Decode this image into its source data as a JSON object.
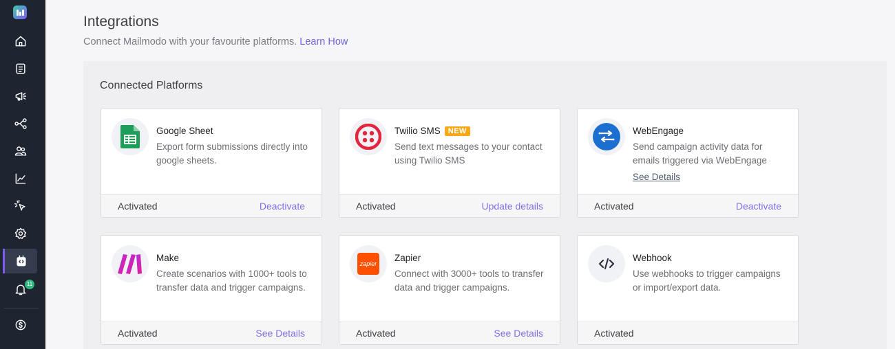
{
  "header": {
    "title": "Integrations",
    "subtitle": "Connect Mailmodo with your favourite platforms.",
    "learn_link": "Learn How"
  },
  "sidebar": {
    "notification_count": "11",
    "items": [
      {
        "icon": "home-icon"
      },
      {
        "icon": "templates-icon"
      },
      {
        "icon": "campaigns-icon"
      },
      {
        "icon": "journeys-icon"
      },
      {
        "icon": "contacts-icon"
      },
      {
        "icon": "analytics-icon"
      },
      {
        "icon": "click-icon"
      },
      {
        "icon": "settings-icon"
      },
      {
        "icon": "integrations-icon",
        "active": true
      },
      {
        "icon": "notifications-icon"
      },
      {
        "icon": "billing-icon"
      }
    ]
  },
  "section": {
    "title": "Connected Platforms"
  },
  "cards": [
    {
      "name": "Google Sheet",
      "desc": "Export form submissions directly into google sheets.",
      "status": "Activated",
      "action": "Deactivate",
      "icon": "google-sheets-icon"
    },
    {
      "name": "Twilio SMS",
      "tag": "NEW",
      "desc": "Send text messages to your contact using Twilio SMS",
      "status": "Activated",
      "action": "Update details",
      "icon": "twilio-icon"
    },
    {
      "name": "WebEngage",
      "desc": "Send campaign activity data for emails triggered via WebEngage",
      "link": "See Details",
      "status": "Activated",
      "action": "Deactivate",
      "icon": "webengage-icon"
    },
    {
      "name": "Make",
      "desc": "Create scenarios with 1000+ tools to transfer data and trigger campaigns.",
      "status": "Activated",
      "action": "See Details",
      "icon": "make-icon"
    },
    {
      "name": "Zapier",
      "icon_text": "zapier",
      "desc": "Connect with 3000+ tools to transfer data and trigger campaigns.",
      "status": "Activated",
      "action": "See Details",
      "icon": "zapier-icon"
    },
    {
      "name": "Webhook",
      "desc": "Use webhooks to trigger campaigns or import/export data.",
      "status": "Activated",
      "action": "",
      "icon": "webhook-icon"
    }
  ],
  "colors": {
    "sidebar": "#1e2430",
    "accent": "#7c5cf4",
    "link": "#6e63dd",
    "badge": "#2eb67d",
    "new_tag": "#f7a91a"
  }
}
